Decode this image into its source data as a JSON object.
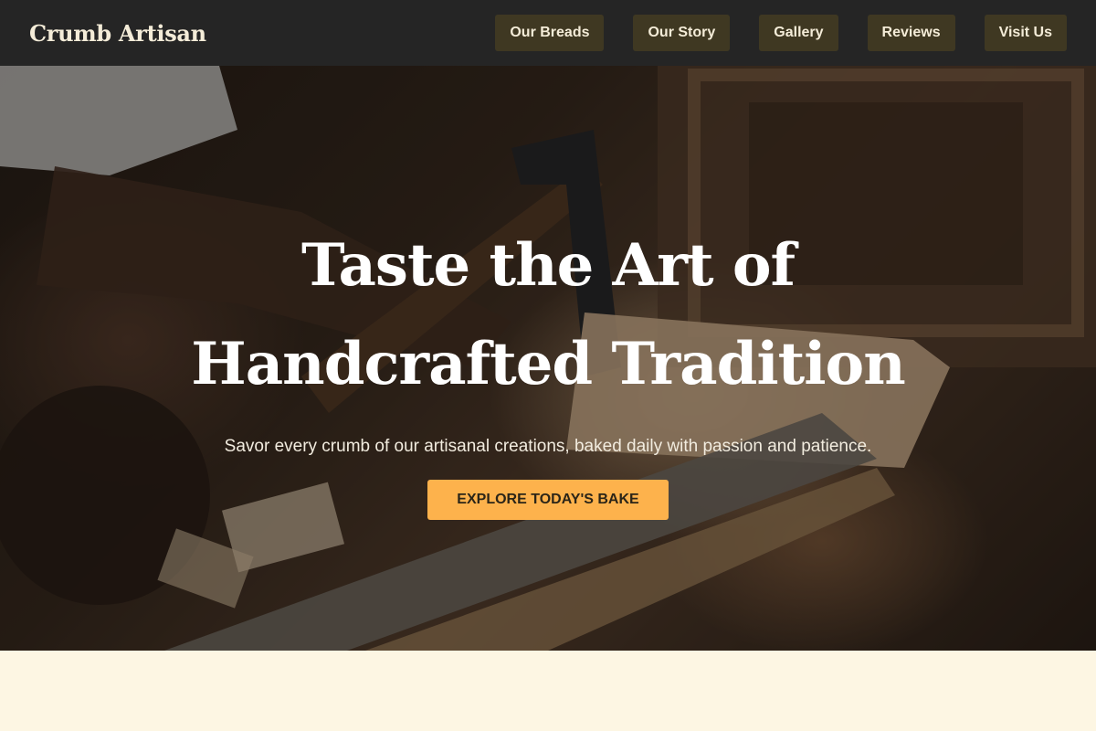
{
  "header": {
    "brand": "Crumb Artisan",
    "nav": [
      "Our Breads",
      "Our Story",
      "Gallery",
      "Reviews",
      "Visit Us"
    ]
  },
  "hero": {
    "title_line1": "Taste the Art of",
    "title_line2": "Handcrafted Tradition",
    "subtitle": "Savor every crumb of our artisanal creations, baked daily with passion and patience.",
    "cta": "EXPLORE TODAY'S BAKE"
  },
  "colors": {
    "header_bg": "#252525",
    "nav_button_bg": "#3f3822",
    "cta_bg": "#fdb24c",
    "section_bg": "#fdf6e3"
  }
}
